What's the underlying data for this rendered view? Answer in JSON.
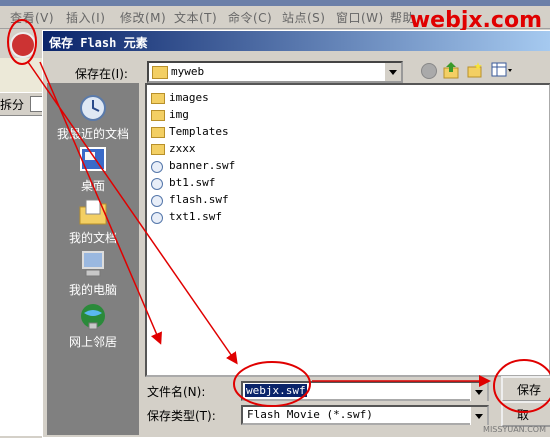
{
  "menubar": {
    "items": [
      "查看(V)",
      "插入(I)",
      "修改(M)",
      "文本(T)",
      "命令(C)",
      "站点(S)",
      "窗口(W)",
      "帮助"
    ],
    "brand": "webjx.com"
  },
  "left_panel": {
    "tab_label": "拆分"
  },
  "dialog": {
    "title": "保存 Flash 元素",
    "save_in_label": "保存在(I):",
    "save_in_value": "myweb",
    "places": [
      "我最近的文档",
      "桌面",
      "我的文档",
      "我的电脑",
      "网上邻居"
    ],
    "files": [
      {
        "name": "images",
        "type": "folder"
      },
      {
        "name": "img",
        "type": "folder"
      },
      {
        "name": "Templates",
        "type": "folder"
      },
      {
        "name": "zxxx",
        "type": "folder"
      },
      {
        "name": "banner.swf",
        "type": "swf"
      },
      {
        "name": "bt1.swf",
        "type": "swf"
      },
      {
        "name": "flash.swf",
        "type": "swf"
      },
      {
        "name": "txt1.swf",
        "type": "swf"
      }
    ],
    "filename_label": "文件名(N):",
    "filename_value": "webjx.swf",
    "filetype_label": "保存类型(T):",
    "filetype_value": "Flash Movie (*.swf)",
    "save_button": "保存",
    "cancel_button": "取"
  },
  "watermark": "MISSYUAN.COM",
  "colors": {
    "annotation": "#e00000",
    "title_bar": "#0a246a",
    "brand": "#e00000"
  },
  "icons": [
    "back-icon",
    "up-folder-icon",
    "new-folder-icon",
    "views-icon",
    "folder-icon",
    "swf-file-icon"
  ]
}
